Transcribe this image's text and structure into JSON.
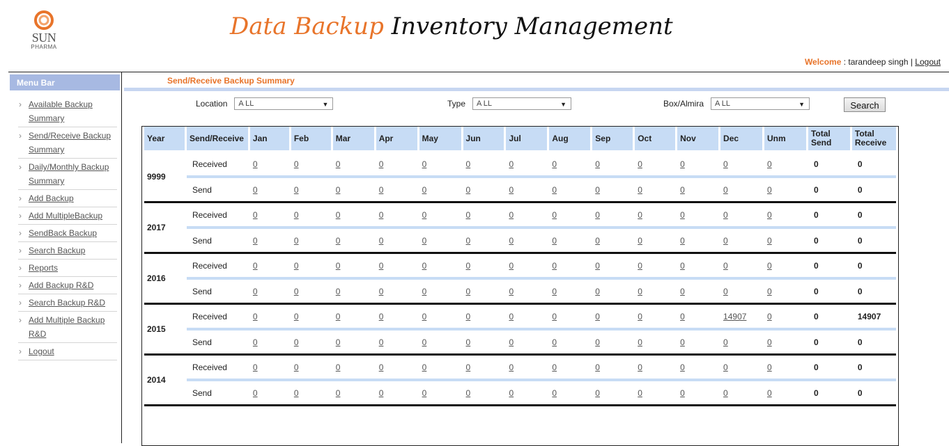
{
  "logo": {
    "brand": "SUN",
    "sub": "PHARMA",
    "colors": {
      "ring": "#e8742a"
    }
  },
  "title": {
    "part1": "Data Backup",
    "part2": "Inventory Management"
  },
  "welcome": {
    "label": "Welcome",
    "separator": " : ",
    "user": "tarandeep singh",
    "pipe": " | ",
    "logout": "Logout"
  },
  "sidebar": {
    "heading": "Menu Bar",
    "items": [
      {
        "label": "Available Backup Summary"
      },
      {
        "label": "Send/Receive Backup Summary"
      },
      {
        "label": "Daily/Monthly Backup Summary"
      },
      {
        "label": "Add Backup"
      },
      {
        "label": "Add MultipleBackup"
      },
      {
        "label": "SendBack Backup"
      },
      {
        "label": "Search Backup"
      },
      {
        "label": "Reports"
      },
      {
        "label": "Add Backup R&D"
      },
      {
        "label": "Search Backup R&D"
      },
      {
        "label": "Add Multiple Backup R&D"
      },
      {
        "label": "Logout"
      }
    ]
  },
  "section_title": "Send/Receive Backup Summary",
  "filters": {
    "location": {
      "label": "Location",
      "value": "A LL"
    },
    "type": {
      "label": "Type",
      "value": "A LL"
    },
    "box": {
      "label": "Box/Almira",
      "value": "A LL"
    },
    "search_label": "Search"
  },
  "table": {
    "headers": [
      "Year",
      "Send/Receive",
      "Jan",
      "Feb",
      "Mar",
      "Apr",
      "May",
      "Jun",
      "Jul",
      "Aug",
      "Sep",
      "Oct",
      "Nov",
      "Dec",
      "Unm",
      "Total Send",
      "Total Receive"
    ],
    "years": [
      {
        "year": "9999",
        "received": {
          "label": "Received",
          "months": [
            "0",
            "0",
            "0",
            "0",
            "0",
            "0",
            "0",
            "0",
            "0",
            "0",
            "0",
            "0",
            "0"
          ],
          "total_send": "0",
          "total_receive": "0"
        },
        "send": {
          "label": "Send",
          "months": [
            "0",
            "0",
            "0",
            "0",
            "0",
            "0",
            "0",
            "0",
            "0",
            "0",
            "0",
            "0",
            "0"
          ],
          "total_send": "0",
          "total_receive": "0"
        }
      },
      {
        "year": "2017",
        "received": {
          "label": "Received",
          "months": [
            "0",
            "0",
            "0",
            "0",
            "0",
            "0",
            "0",
            "0",
            "0",
            "0",
            "0",
            "0",
            "0"
          ],
          "total_send": "0",
          "total_receive": "0"
        },
        "send": {
          "label": "Send",
          "months": [
            "0",
            "0",
            "0",
            "0",
            "0",
            "0",
            "0",
            "0",
            "0",
            "0",
            "0",
            "0",
            "0"
          ],
          "total_send": "0",
          "total_receive": "0"
        }
      },
      {
        "year": "2016",
        "received": {
          "label": "Received",
          "months": [
            "0",
            "0",
            "0",
            "0",
            "0",
            "0",
            "0",
            "0",
            "0",
            "0",
            "0",
            "0",
            "0"
          ],
          "total_send": "0",
          "total_receive": "0"
        },
        "send": {
          "label": "Send",
          "months": [
            "0",
            "0",
            "0",
            "0",
            "0",
            "0",
            "0",
            "0",
            "0",
            "0",
            "0",
            "0",
            "0"
          ],
          "total_send": "0",
          "total_receive": "0"
        }
      },
      {
        "year": "2015",
        "received": {
          "label": "Received",
          "months": [
            "0",
            "0",
            "0",
            "0",
            "0",
            "0",
            "0",
            "0",
            "0",
            "0",
            "0",
            "14907",
            "0"
          ],
          "total_send": "0",
          "total_receive": "14907"
        },
        "send": {
          "label": "Send",
          "months": [
            "0",
            "0",
            "0",
            "0",
            "0",
            "0",
            "0",
            "0",
            "0",
            "0",
            "0",
            "0",
            "0"
          ],
          "total_send": "0",
          "total_receive": "0"
        }
      },
      {
        "year": "2014",
        "received": {
          "label": "Received",
          "months": [
            "0",
            "0",
            "0",
            "0",
            "0",
            "0",
            "0",
            "0",
            "0",
            "0",
            "0",
            "0",
            "0"
          ],
          "total_send": "0",
          "total_receive": "0"
        },
        "send": {
          "label": "Send",
          "months": [
            "0",
            "0",
            "0",
            "0",
            "0",
            "0",
            "0",
            "0",
            "0",
            "0",
            "0",
            "0",
            "0"
          ],
          "total_send": "0",
          "total_receive": "0"
        }
      }
    ]
  },
  "colors": {
    "accent": "#e8742a",
    "header_bg": "#c7dcf5",
    "menu_bg": "#a7b9e2"
  }
}
